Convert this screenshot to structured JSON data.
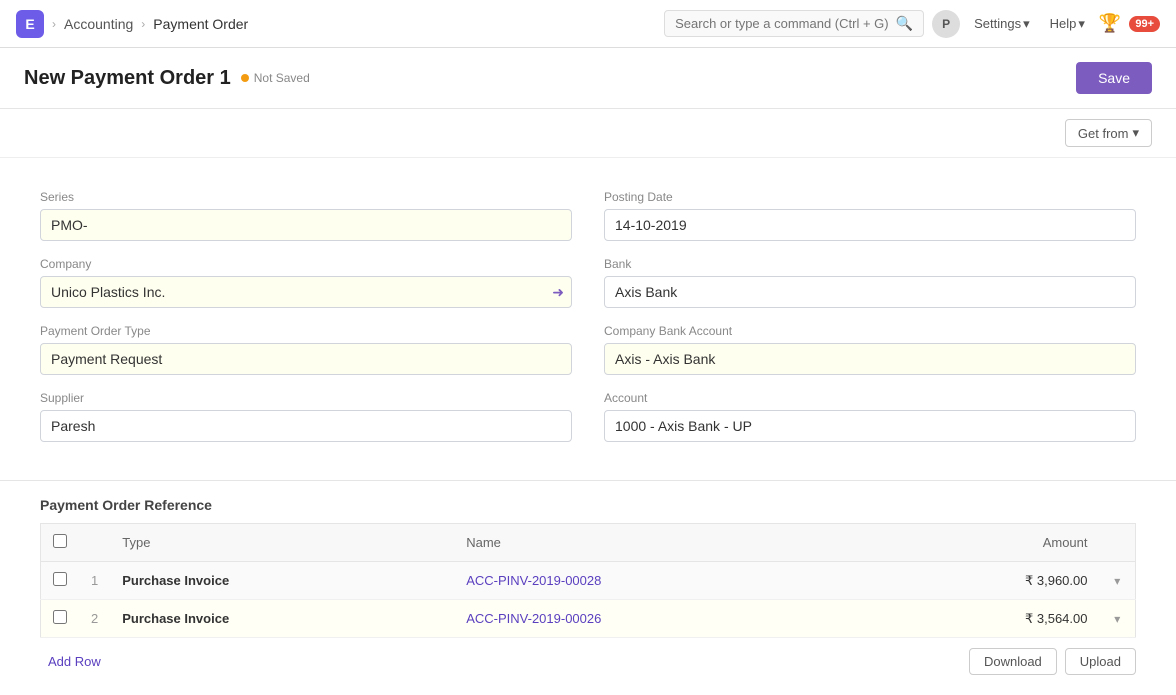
{
  "app": {
    "icon_label": "E",
    "breadcrumbs": [
      "Accounting",
      "Payment Order"
    ],
    "search_placeholder": "Search or type a command (Ctrl + G)",
    "avatar_label": "P",
    "settings_label": "Settings",
    "help_label": "Help",
    "notif_count": "99+"
  },
  "page": {
    "title": "New Payment Order 1",
    "status": "Not Saved",
    "save_label": "Save"
  },
  "get_from_label": "Get from",
  "form": {
    "series_label": "Series",
    "series_value": "PMO-",
    "posting_date_label": "Posting Date",
    "posting_date_value": "14-10-2019",
    "company_label": "Company",
    "company_value": "Unico Plastics Inc.",
    "bank_label": "Bank",
    "bank_value": "Axis Bank",
    "payment_order_type_label": "Payment Order Type",
    "payment_order_type_value": "Payment Request",
    "company_bank_account_label": "Company Bank Account",
    "company_bank_account_value": "Axis - Axis Bank",
    "supplier_label": "Supplier",
    "supplier_value": "Paresh",
    "account_label": "Account",
    "account_value": "1000 - Axis Bank - UP"
  },
  "reference_table": {
    "section_title": "Payment Order Reference",
    "columns": [
      "",
      "",
      "Type",
      "Name",
      "Amount",
      ""
    ],
    "rows": [
      {
        "num": "1",
        "type": "Purchase Invoice",
        "name": "ACC-PINV-2019-00028",
        "amount": "₹ 3,960.00"
      },
      {
        "num": "2",
        "type": "Purchase Invoice",
        "name": "ACC-PINV-2019-00026",
        "amount": "₹ 3,564.00"
      }
    ],
    "add_row_label": "Add Row",
    "download_label": "Download",
    "upload_label": "Upload"
  }
}
